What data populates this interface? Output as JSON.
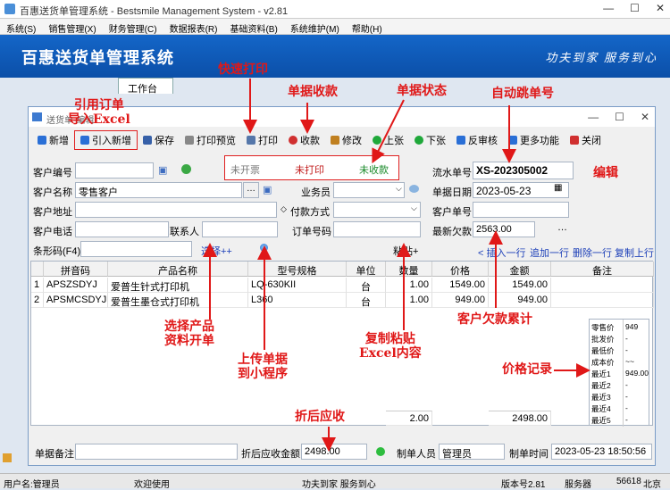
{
  "window": {
    "title": "百惠送货单管理系统 - Bestsmile Management System - v2.81",
    "controls": [
      "—",
      "☐",
      "✕"
    ]
  },
  "menu": [
    "系统(S)",
    "销售管理(X)",
    "财务管理(C)",
    "数据报表(R)",
    "基础资料(B)",
    "系统维护(M)",
    "帮助(H)"
  ],
  "banner": {
    "title": "百惠送货单管理系统",
    "slogan": "功夫到家  服务到心"
  },
  "tab": {
    "label": "工作台"
  },
  "dialog": {
    "title": "送货单-编辑",
    "controls": [
      "—",
      "☐",
      "✕"
    ]
  },
  "toolbar": [
    {
      "label": "新增",
      "icon": "plus-icon",
      "color": "#2a6fd6"
    },
    {
      "label": "引入新增",
      "icon": "plus-icon",
      "color": "#2a6fd6"
    },
    {
      "label": "保存",
      "icon": "save-icon",
      "color": "#3660a8"
    },
    {
      "label": "打印预览",
      "icon": "printer-preview-icon",
      "color": "#777"
    },
    {
      "label": "打印",
      "icon": "printer-icon",
      "color": "#5577aa"
    },
    {
      "label": "收款",
      "icon": "coins-icon",
      "color": "#d03030"
    },
    {
      "label": "修改",
      "icon": "edit-icon",
      "color": "#c08020"
    },
    {
      "label": "上张",
      "icon": "up-icon",
      "color": "#1fa83a"
    },
    {
      "label": "下张",
      "icon": "down-icon",
      "color": "#1fa83a"
    },
    {
      "label": "反审核",
      "icon": "unaudit-icon",
      "color": "#2a6fd6"
    },
    {
      "label": "更多功能",
      "icon": "more-icon",
      "color": "#2a6fd6"
    },
    {
      "label": "关闭",
      "icon": "close-icon",
      "color": "#d03030"
    }
  ],
  "status": {
    "open": "未开票",
    "print": "未打印",
    "receive": "未收款"
  },
  "form": {
    "customer_code_label": "客户编号",
    "customer_code": "",
    "customer_name_label": "客户名称",
    "customer_name": "零售客户",
    "customer_addr_label": "客户地址",
    "customer_addr": "",
    "customer_phone_label": "客户电话",
    "customer_phone": "",
    "contact_label": "联系人",
    "contact": "",
    "salesperson_label": "业务员",
    "salesperson": "",
    "payment_label": "付款方式",
    "payment": "",
    "order_no_label": "订单号码",
    "order_no": "",
    "serial_label": "流水单号",
    "serial": "XS-202305002",
    "date_label": "单据日期",
    "date": "2023-05-23",
    "cust_doc_label": "客户单号",
    "cust_doc": "",
    "balance_label": "最新欠款",
    "balance": "2563.00",
    "barcode_label": "条形码(F4)",
    "barcode": ""
  },
  "links": {
    "select": "选择++",
    "paste": "粘贴+",
    "insert": "< 插入一行",
    "append": "追加一行",
    "delete": "删除一行",
    "copy": "复制上行"
  },
  "grid": {
    "headers": [
      "",
      "拼音码",
      "产品名称",
      "型号规格",
      "单位",
      "数量",
      "价格",
      "金额",
      "备注"
    ],
    "rows": [
      [
        "1",
        "APSZSDYJ",
        "爱普生针式打印机",
        "LQ-630KII",
        "台",
        "1.00",
        "1549.00",
        "1549.00",
        ""
      ],
      [
        "2",
        "APSMCSDYJ",
        "爱普生墨仓式打印机",
        "L360",
        "台",
        "1.00",
        "949.00",
        "949.00",
        ""
      ]
    ],
    "total_qty": "2.00",
    "total_amount": "2498.00"
  },
  "price_panel": [
    {
      "k": "零售价",
      "v": "949"
    },
    {
      "k": "批发价",
      "v": "-"
    },
    {
      "k": "最低价",
      "v": "-"
    },
    {
      "k": "成本价",
      "v": "~~"
    },
    {
      "k": "最近1",
      "v": "949.00"
    },
    {
      "k": "最近2",
      "v": "-"
    },
    {
      "k": "最近3",
      "v": "-"
    },
    {
      "k": "最近4",
      "v": "-"
    },
    {
      "k": "最近5",
      "v": "-"
    }
  ],
  "footer": {
    "remark_label": "单据备注",
    "remark": "",
    "due_label": "折后应收金额",
    "due": "2498.00",
    "maker_label": "制单人员",
    "maker": "管理员",
    "time_label": "制单时间",
    "time": "2023-05-23 18:50:56"
  },
  "statusbar": {
    "user": "用户名:管理员",
    "welcome": "欢迎使用",
    "slogan": "功夫到家 服务到心",
    "version": "版本号2.81",
    "service": "服务器",
    "num": "56618",
    "extra": "北京"
  },
  "annotations": {
    "import_order": "引用订单\n导入Excel",
    "quick_print": "快速打印",
    "receive": "单据收款",
    "status": "单据状态",
    "auto_no": "自动跳单号",
    "edit": "编辑",
    "select_product": "选择产品\n资料开单",
    "upload": "上传单据\n到小程序",
    "paste_excel": "复制粘贴\nExcel内容",
    "debt": "客户欠款累计",
    "price_record": "价格记录",
    "discount": "折后应收"
  },
  "colors": {
    "banner": "#0b4fa8",
    "annotation": "#e01818",
    "link": "#1c3fb8"
  }
}
